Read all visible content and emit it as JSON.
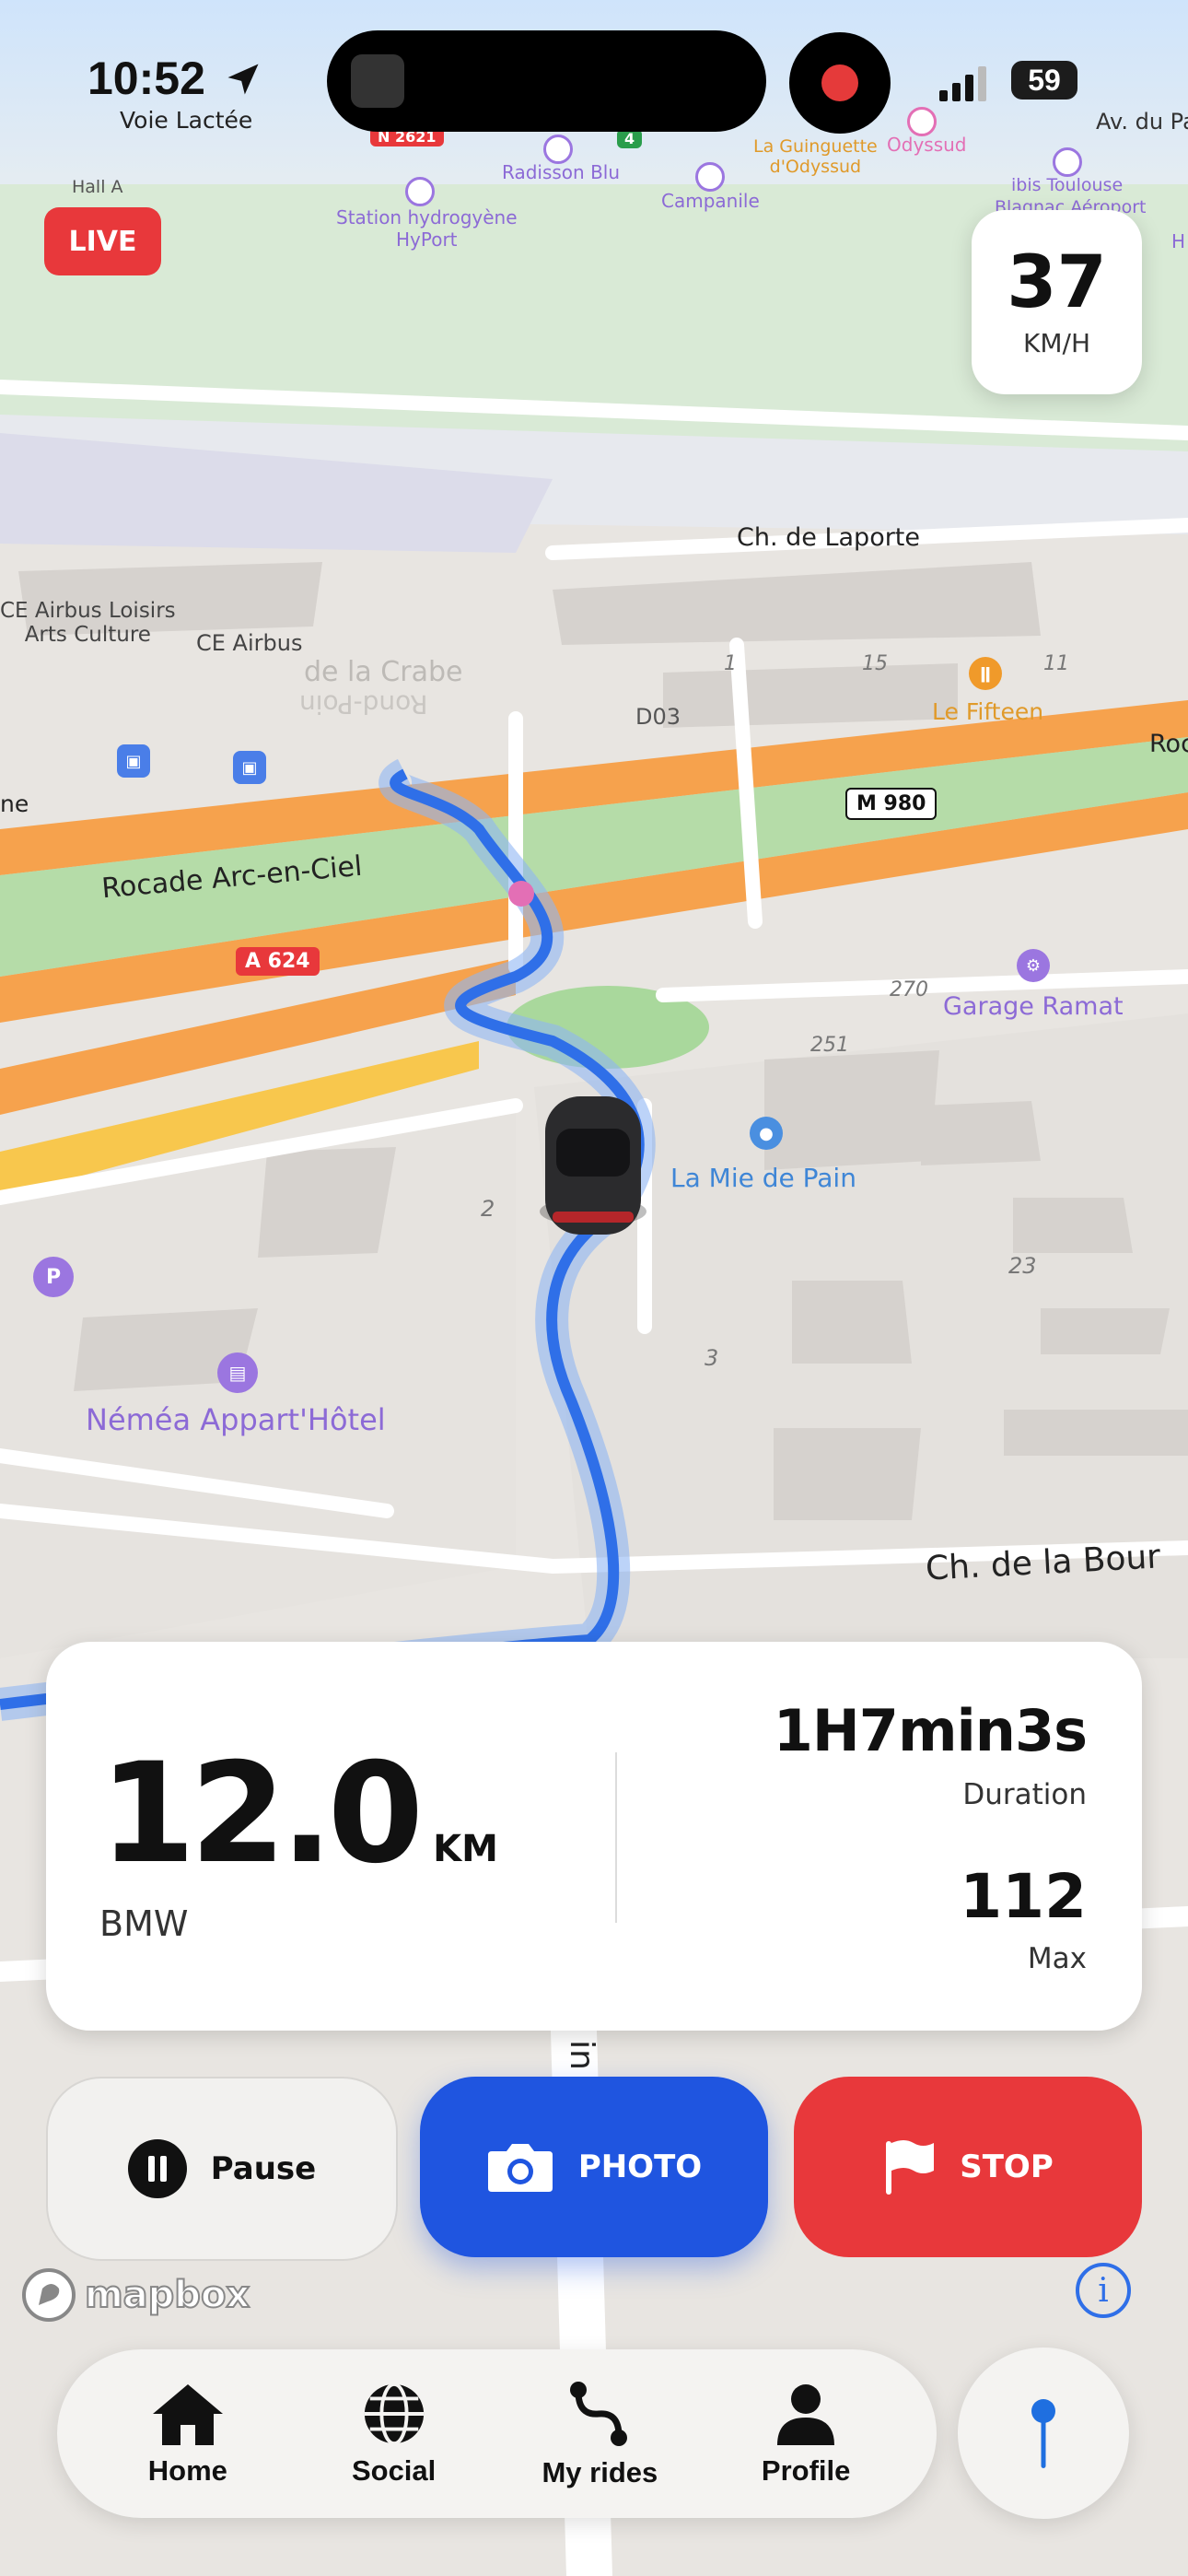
{
  "status_bar": {
    "time": "10:52",
    "location_subtitle": "Voie Lactée",
    "battery": "59"
  },
  "live_badge": "LIVE",
  "speed": {
    "value": "37",
    "unit": "KM/H"
  },
  "map_labels": {
    "n_road": "N 2621",
    "hall_a": "Hall A",
    "radisson": "Radisson Blu",
    "green_4": "4",
    "guinguette": "La Guinguette\nd'Odyssud",
    "odyssud": "Odyssud",
    "av_du_pa": "Av. du Pa",
    "station": "Station hydrogyène\nHyPort",
    "campanile": "Campanile",
    "ibis": "ibis Toulouse",
    "ibis2": "Blagnac Aéroport",
    "h_cut": "H",
    "laporte": "Ch. de Laporte",
    "airbus_loisirs": "CE Airbus Loisirs\nArts Culture",
    "ce_airbus": "CE Airbus",
    "crabe": "de la Crabe",
    "crabe_rev": "Rond-Poin",
    "d03": "D03",
    "n1": "1",
    "n15": "15",
    "n11": "11",
    "le_fifteen": "Le Fifteen",
    "rocade_cut": "Roc",
    "ne_cut": "ne",
    "m980": "M 980",
    "rocade_arc": "Rocade Arc-en-Ciel",
    "a624": "A 624",
    "n270": "270",
    "garage": "Garage Ramat",
    "n251": "251",
    "mie_de_pain": "La Mie de Pain",
    "n2": "2",
    "n23": "23",
    "n3": "3",
    "nemea": "Néméa Appart'Hôtel",
    "bour": "Ch. de la Bour",
    "in_cut": "in"
  },
  "stats": {
    "distance": "12.0",
    "distance_unit": "KM",
    "vehicle": "BMW",
    "duration": "1H7min3s",
    "duration_label": "Duration",
    "max": "112",
    "max_label": "Max"
  },
  "actions": {
    "pause": "Pause",
    "photo": "PHOTO",
    "stop": "STOP"
  },
  "attribution": "mapbox",
  "nav": [
    {
      "label": "Home",
      "icon": "home-icon"
    },
    {
      "label": "Social",
      "icon": "globe-icon"
    },
    {
      "label": "My rides",
      "icon": "route-icon"
    },
    {
      "label": "Profile",
      "icon": "person-icon"
    }
  ],
  "colors": {
    "accent_blue": "#1f55e0",
    "stop_red": "#e8383b",
    "live_red": "#e8383b",
    "route_blue": "#2f6fe8"
  }
}
